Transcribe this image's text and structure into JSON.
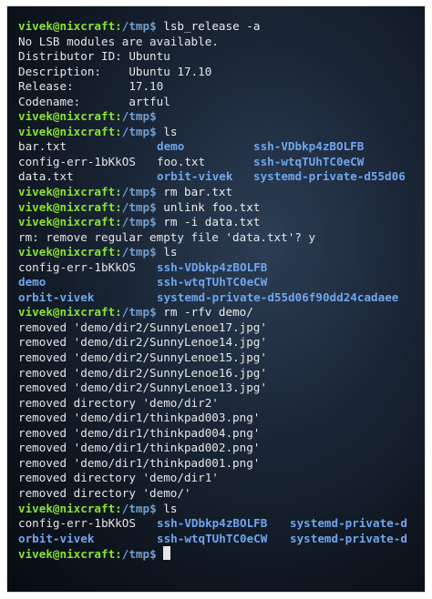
{
  "prompt": {
    "user": "vivek@nixcraft",
    "sep": ":",
    "path": "/tmp",
    "sym": "$ "
  },
  "lines": [
    {
      "kind": "cmd",
      "text": "lsb_release -a"
    },
    {
      "kind": "out",
      "text": "No LSB modules are available."
    },
    {
      "kind": "out",
      "text": "Distributor ID: Ubuntu"
    },
    {
      "kind": "out",
      "text": "Description:    Ubuntu 17.10"
    },
    {
      "kind": "out",
      "text": "Release:        17.10"
    },
    {
      "kind": "out",
      "text": "Codename:       artful"
    },
    {
      "kind": "cmd",
      "text": ""
    },
    {
      "kind": "cmd",
      "text": "ls"
    },
    {
      "kind": "ls1",
      "cells": [
        {
          "text": "bar.txt",
          "dir": false
        },
        {
          "text": "demo",
          "dir": true
        },
        {
          "text": "ssh-VDbkp4zBOLFB",
          "dir": true
        }
      ]
    },
    {
      "kind": "ls1",
      "cells": [
        {
          "text": "config-err-1bKkOS",
          "dir": false
        },
        {
          "text": "foo.txt",
          "dir": false
        },
        {
          "text": "ssh-wtqTUhTC0eCW",
          "dir": true
        }
      ]
    },
    {
      "kind": "ls1",
      "cells": [
        {
          "text": "data.txt",
          "dir": false
        },
        {
          "text": "orbit-vivek",
          "dir": true
        },
        {
          "text": "systemd-private-d55d06",
          "dir": true
        }
      ]
    },
    {
      "kind": "cmd",
      "text": "rm bar.txt"
    },
    {
      "kind": "cmd",
      "text": "unlink foo.txt"
    },
    {
      "kind": "cmd",
      "text": "rm -i data.txt"
    },
    {
      "kind": "out",
      "text": "rm: remove regular empty file 'data.txt'? y"
    },
    {
      "kind": "cmd",
      "text": "ls"
    },
    {
      "kind": "ls2",
      "cells": [
        {
          "text": "config-err-1bKkOS",
          "dir": false
        },
        {
          "text": "ssh-VDbkp4zBOLFB",
          "dir": true
        }
      ]
    },
    {
      "kind": "ls2",
      "cells": [
        {
          "text": "demo",
          "dir": true
        },
        {
          "text": "ssh-wtqTUhTC0eCW",
          "dir": true
        }
      ]
    },
    {
      "kind": "ls2",
      "cells": [
        {
          "text": "orbit-vivek",
          "dir": true
        },
        {
          "text": "systemd-private-d55d06f90dd24cadaee",
          "dir": true
        }
      ]
    },
    {
      "kind": "cmd",
      "text": "rm -rfv demo/"
    },
    {
      "kind": "out",
      "text": "removed 'demo/dir2/SunnyLenoe17.jpg'"
    },
    {
      "kind": "out",
      "text": "removed 'demo/dir2/SunnyLenoe14.jpg'"
    },
    {
      "kind": "out",
      "text": "removed 'demo/dir2/SunnyLenoe15.jpg'"
    },
    {
      "kind": "out",
      "text": "removed 'demo/dir2/SunnyLenoe16.jpg'"
    },
    {
      "kind": "out",
      "text": "removed 'demo/dir2/SunnyLenoe13.jpg'"
    },
    {
      "kind": "out",
      "text": "removed directory 'demo/dir2'"
    },
    {
      "kind": "out",
      "text": "removed 'demo/dir1/thinkpad003.png'"
    },
    {
      "kind": "out",
      "text": "removed 'demo/dir1/thinkpad004.png'"
    },
    {
      "kind": "out",
      "text": "removed 'demo/dir1/thinkpad002.png'"
    },
    {
      "kind": "out",
      "text": "removed 'demo/dir1/thinkpad001.png'"
    },
    {
      "kind": "out",
      "text": "removed directory 'demo/dir1'"
    },
    {
      "kind": "out",
      "text": "removed directory 'demo/'"
    },
    {
      "kind": "cmd",
      "text": "ls"
    },
    {
      "kind": "ls3",
      "cells": [
        {
          "text": "config-err-1bKkOS",
          "dir": false
        },
        {
          "text": "ssh-VDbkp4zBOLFB",
          "dir": true
        },
        {
          "text": "systemd-private-d",
          "dir": true
        }
      ]
    },
    {
      "kind": "ls3",
      "cells": [
        {
          "text": "orbit-vivek",
          "dir": true
        },
        {
          "text": "ssh-wtqTUhTC0eCW",
          "dir": true
        },
        {
          "text": "systemd-private-d",
          "dir": true
        }
      ]
    },
    {
      "kind": "cmd",
      "text": "",
      "cursor": true
    }
  ],
  "colors": {
    "prompt_user": "#8ae234",
    "prompt_path": "#729fcf",
    "directory": "#6fa6ee",
    "text": "#e6e6e6"
  }
}
